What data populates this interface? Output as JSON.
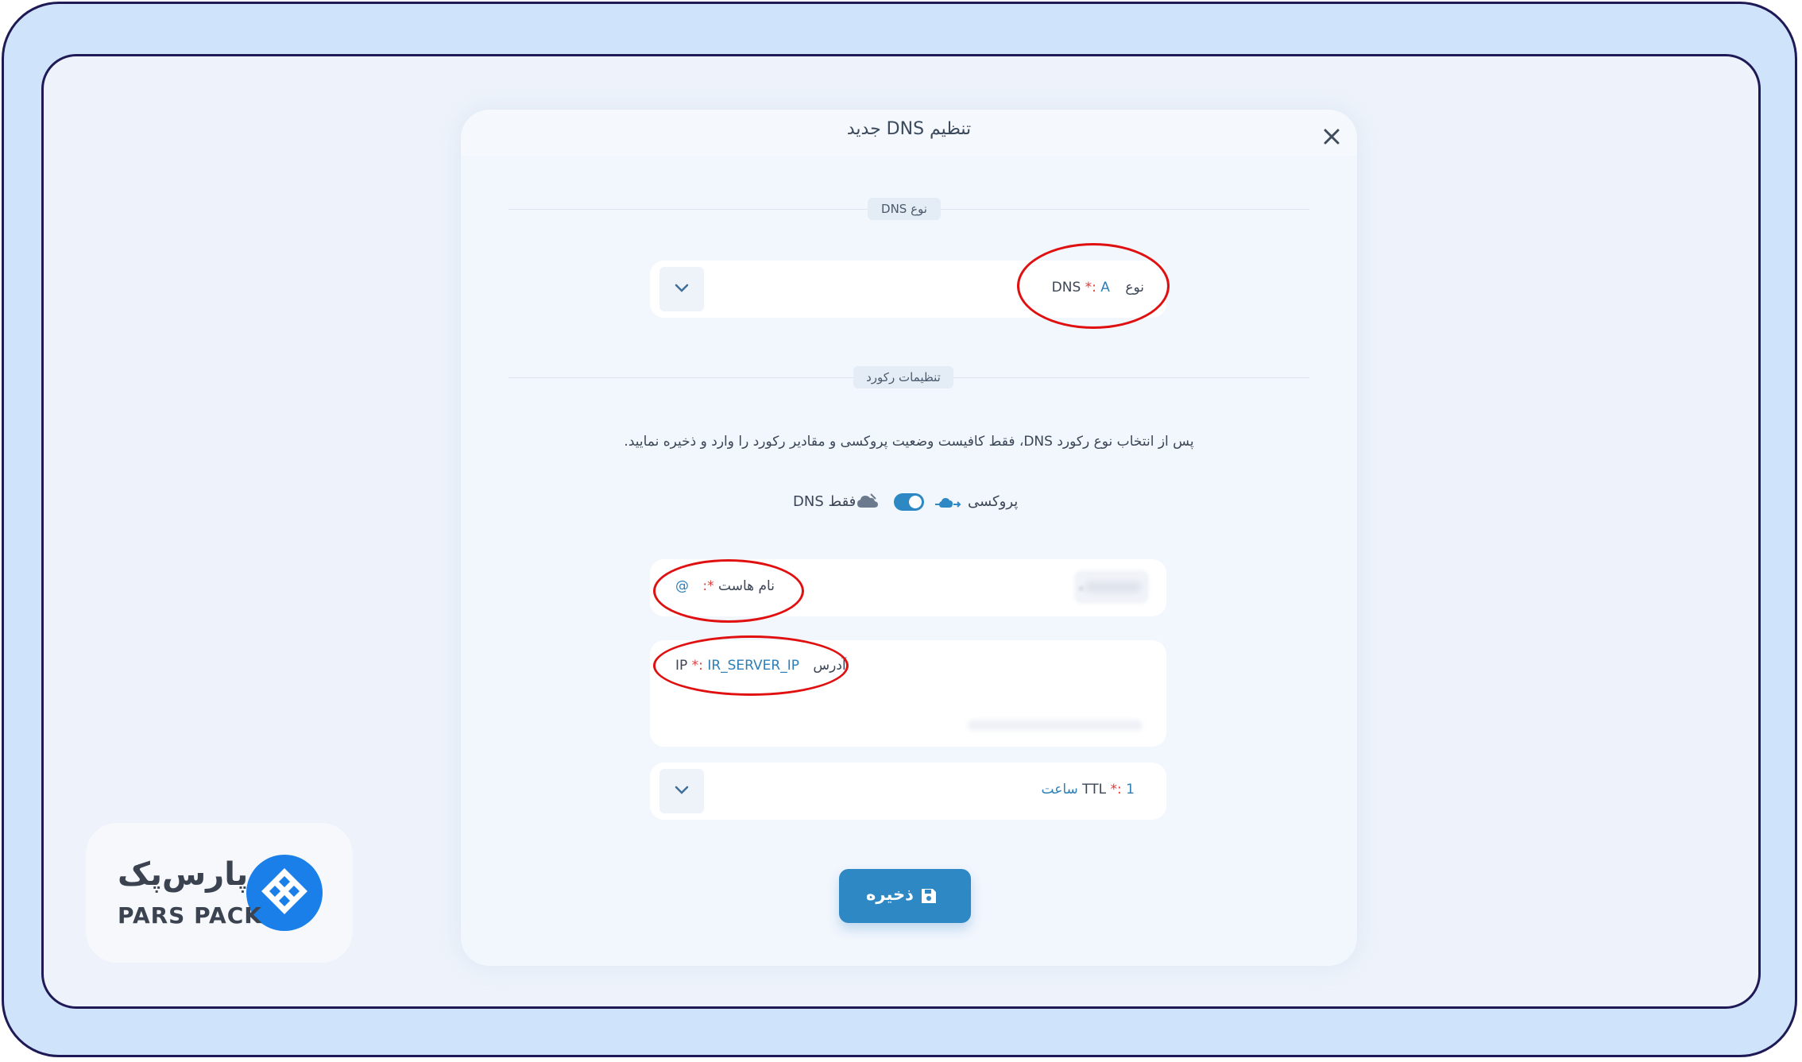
{
  "modal": {
    "title": "تنظیم DNS جدید"
  },
  "sections": {
    "dns_type": "نوع DNS",
    "record_settings": "تنظیمات رکورد"
  },
  "dns_type_field": {
    "label": "نوع DNS",
    "required_mark": "*:",
    "value": "A"
  },
  "info_text": "پس از انتخاب نوع رکورد DNS، فقط کافیست وضعیت پروکسی و مقادیر رکورد را وارد و ذخیره نمایید.",
  "proxy": {
    "proxy_label": "پروکسی",
    "dns_only_label": "فقط DNS",
    "proxy_enabled": true
  },
  "host_field": {
    "label": "نام هاست",
    "required_mark": "*:",
    "value": "@",
    "domain_suffix": "."
  },
  "ip_field": {
    "label": "آدرس IP",
    "required_mark": "*:",
    "value": "IR_SERVER_IP"
  },
  "ttl_field": {
    "label": "TTL",
    "required_mark": "*:",
    "value": "1 ساعت"
  },
  "save_button": {
    "label": "ذخیره"
  },
  "brand": {
    "name_fa": "پارس‌پک",
    "name_en": "PARS PACK",
    "color": "#1a7fe8"
  },
  "colors": {
    "accent": "#2e88c4",
    "highlight_circle": "#e01010",
    "required": "#e23a3a",
    "frame_border": "#1f1a55",
    "frame_bg": "#cfe4fb"
  }
}
